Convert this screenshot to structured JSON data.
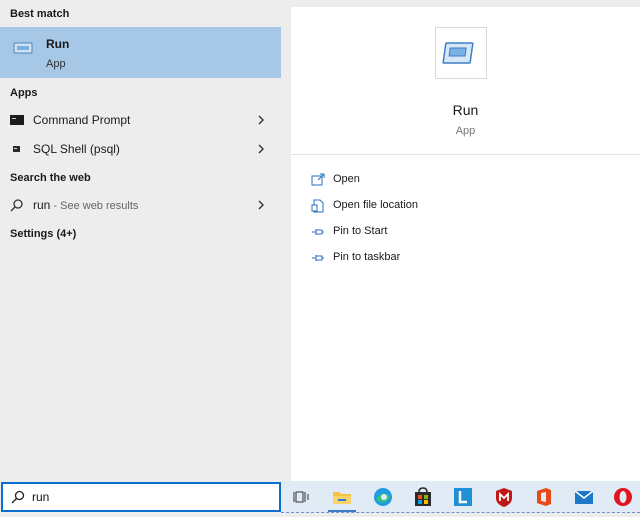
{
  "best_match": {
    "header": "Best match",
    "title": "Run",
    "subtitle": "App"
  },
  "apps": {
    "header": "Apps",
    "items": [
      {
        "label": "Command Prompt",
        "icon": "terminal-icon"
      },
      {
        "label": "SQL Shell (psql)",
        "icon": "sql-shell-icon"
      }
    ]
  },
  "web": {
    "header": "Search the web",
    "query": "run",
    "hint": " - See web results"
  },
  "settings": {
    "header": "Settings (4+)"
  },
  "detail": {
    "title": "Run",
    "subtitle": "App",
    "actions": [
      {
        "label": "Open",
        "icon": "open-icon"
      },
      {
        "label": "Open file location",
        "icon": "file-location-icon"
      },
      {
        "label": "Pin to Start",
        "icon": "pin-icon"
      },
      {
        "label": "Pin to taskbar",
        "icon": "pin-icon"
      }
    ]
  },
  "search": {
    "value": "run"
  },
  "taskbar": {
    "items": [
      "task-view-icon",
      "file-explorer-icon",
      "edge-icon",
      "store-icon",
      "l-app-icon",
      "mcafee-icon",
      "office-icon",
      "mail-icon",
      "opera-icon"
    ]
  },
  "colors": {
    "selection": "#a6c8e6",
    "accent": "#0a6ed1",
    "taskbar": "#e0ebf5"
  }
}
